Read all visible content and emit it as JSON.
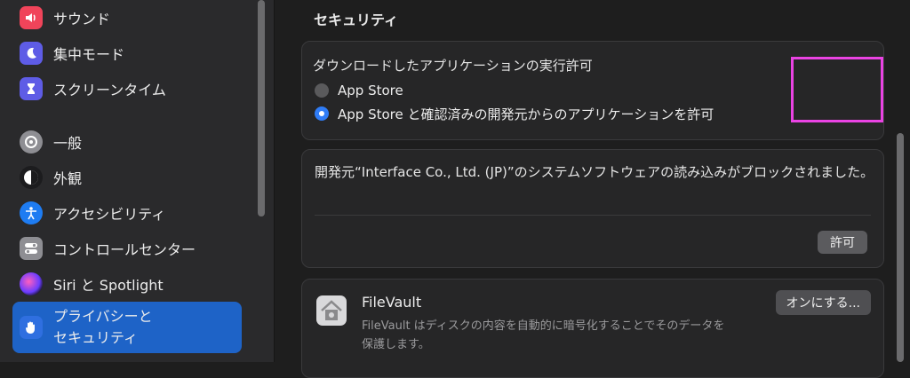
{
  "sidebar": {
    "items": [
      {
        "label": "サウンド",
        "icon": "speaker-icon",
        "color": "#f0445a"
      },
      {
        "label": "集中モード",
        "icon": "moon-icon",
        "color": "#5e5ce6"
      },
      {
        "label": "スクリーンタイム",
        "icon": "hourglass-icon",
        "color": "#5e5ce6"
      },
      {
        "label": "一般",
        "icon": "gear-icon",
        "color": "#8e8e93"
      },
      {
        "label": "外観",
        "icon": "appearance-icon",
        "color": "#1c1c1e"
      },
      {
        "label": "アクセシビリティ",
        "icon": "accessibility-icon",
        "color": "#1e7cf2"
      },
      {
        "label": "コントロールセンター",
        "icon": "control-center-icon",
        "color": "#8e8e93"
      },
      {
        "label": "Siri と Spotlight",
        "icon": "siri-icon",
        "color": "#7a4ad8"
      },
      {
        "label": "プライバシーと\nセキュリティ",
        "icon": "hand-icon",
        "color": "#2f6fe0",
        "selected": true
      }
    ]
  },
  "main": {
    "section_title": "セキュリティ",
    "download_card": {
      "title": "ダウンロードしたアプリケーションの実行許可",
      "options": [
        {
          "label": "App Store",
          "selected": false
        },
        {
          "label": "App Store と確認済みの開発元からのアプリケーションを許可",
          "selected": true
        }
      ]
    },
    "blocked_card": {
      "message": "開発元“Interface Co., Ltd. (JP)”のシステムソフトウェアの読み込みがブロックされました。",
      "allow_button": "許可"
    },
    "filevault_card": {
      "title": "FileVault",
      "description": "FileVault はディスクの内容を自動的に暗号化することでそのデータを保護します。",
      "button": "オンにする..."
    }
  },
  "colors": {
    "accent": "#1e63c7",
    "highlight": "#ea43e3"
  }
}
